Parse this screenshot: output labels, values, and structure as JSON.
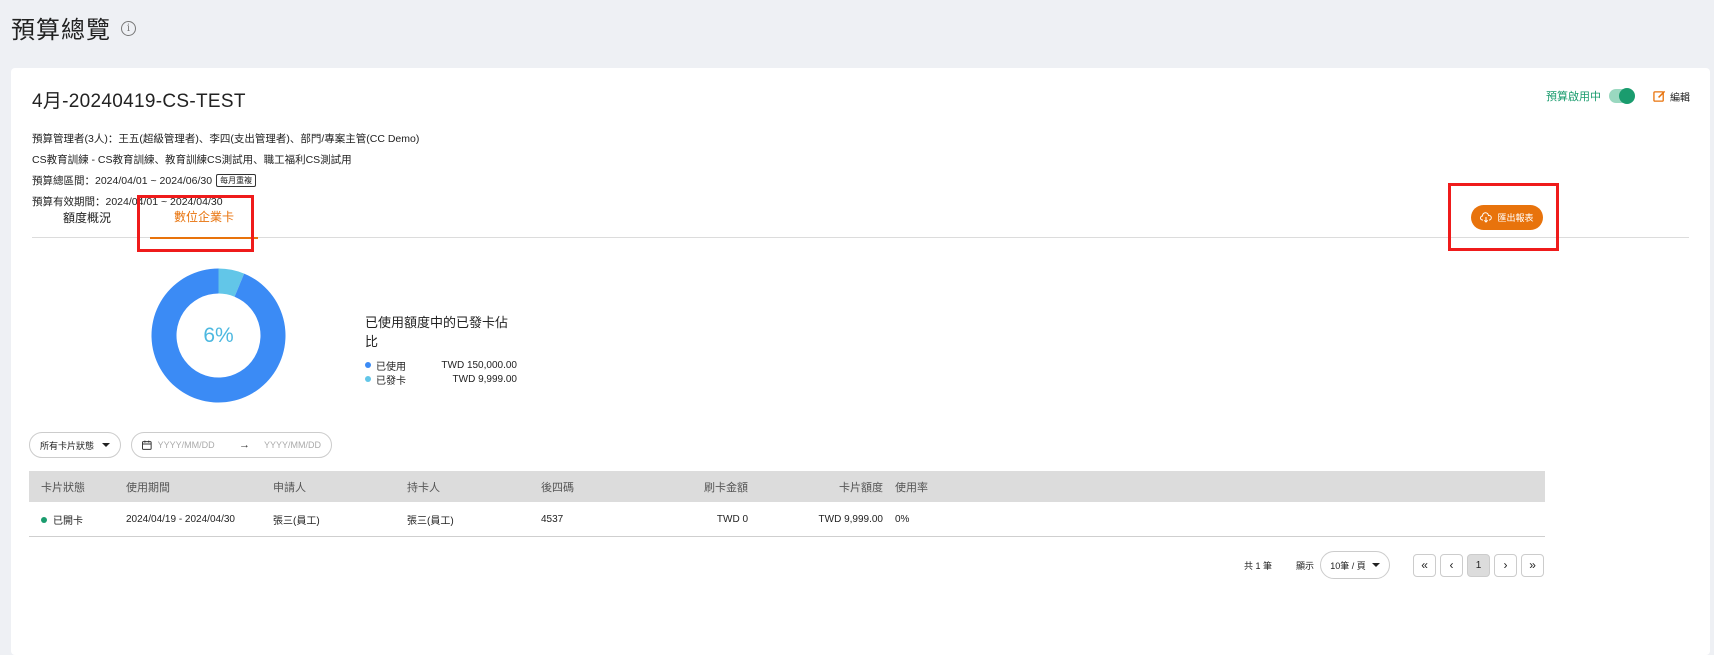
{
  "page": {
    "title": "預算總覽"
  },
  "budget": {
    "name": "4月-20240419-CS-TEST",
    "status_label": "預算啟用中",
    "edit_label": "編輯",
    "managers": "預算管理者(3人)：王五(超級管理者)、李四(支出管理者)、部門/專案主管(CC Demo)",
    "categories": "CS教育訓練 - CS教育訓練、教育訓練CS測試用、職工福利CS測試用",
    "total_period": "預算總區間：2024/04/01 ~ 2024/06/30",
    "repeat_tag": "每月重複",
    "valid_period": "預算有效期間：2024/04/01 ~ 2024/04/30"
  },
  "tabs": [
    {
      "label": "額度概況"
    },
    {
      "label": "數位企業卡"
    }
  ],
  "export_label": "匯出報表",
  "chart_data": {
    "type": "pie",
    "center_label": "6%",
    "title": "已使用額度中的已發卡佔比",
    "slices": [
      {
        "name": "已使用",
        "value": 150000,
        "display": "TWD 150,000.00",
        "color": "#3b8bf5"
      },
      {
        "name": "已發卡",
        "value": 9999,
        "display": "TWD 9,999.00",
        "color": "#62c6e8"
      }
    ]
  },
  "filters": {
    "card_status": "所有卡片狀態",
    "date_from_placeholder": "YYYY/MM/DD",
    "date_to_placeholder": "YYYY/MM/DD"
  },
  "table": {
    "headers": [
      "卡片狀態",
      "使用期間",
      "申請人",
      "持卡人",
      "後四碼",
      "刷卡金額",
      "卡片額度",
      "使用率"
    ],
    "rows": [
      [
        "已開卡",
        "2024/04/19 - 2024/04/30",
        "張三(員工)",
        "張三(員工)",
        "4537",
        "TWD 0",
        "TWD 9,999.00",
        "0%"
      ]
    ]
  },
  "pagination": {
    "total": "共 1 筆",
    "show_label": "顯示",
    "per_page": "10筆 / 頁",
    "first": "«",
    "prev": "‹",
    "current": "1",
    "next": "›",
    "last": "»"
  }
}
